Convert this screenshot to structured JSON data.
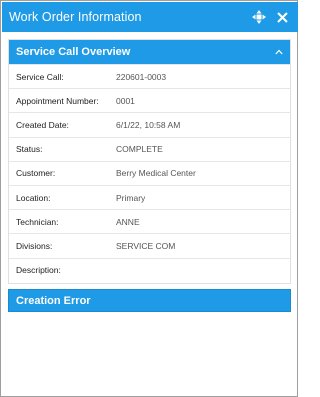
{
  "window": {
    "title": "Work Order Information",
    "move_icon": "move-arrows-icon",
    "close_icon": "close-icon"
  },
  "overview": {
    "header": "Service Call Overview",
    "collapse_icon": "chevron-up-icon",
    "fields": [
      {
        "label": "Service Call:",
        "value": "220601-0003"
      },
      {
        "label": "Appointment Number:",
        "value": "0001"
      },
      {
        "label": "Created Date:",
        "value": "6/1/22, 10:58 AM"
      },
      {
        "label": "Status:",
        "value": "COMPLETE"
      },
      {
        "label": "Customer:",
        "value": "Berry Medical Center"
      },
      {
        "label": "Location:",
        "value": "Primary"
      },
      {
        "label": "Technician:",
        "value": "ANNE"
      },
      {
        "label": "Divisions:",
        "value": "SERVICE COM"
      },
      {
        "label": "Description:",
        "value": ""
      }
    ]
  },
  "error_section": {
    "header": "Creation Error"
  },
  "colors": {
    "accent": "#1e9ae6"
  }
}
